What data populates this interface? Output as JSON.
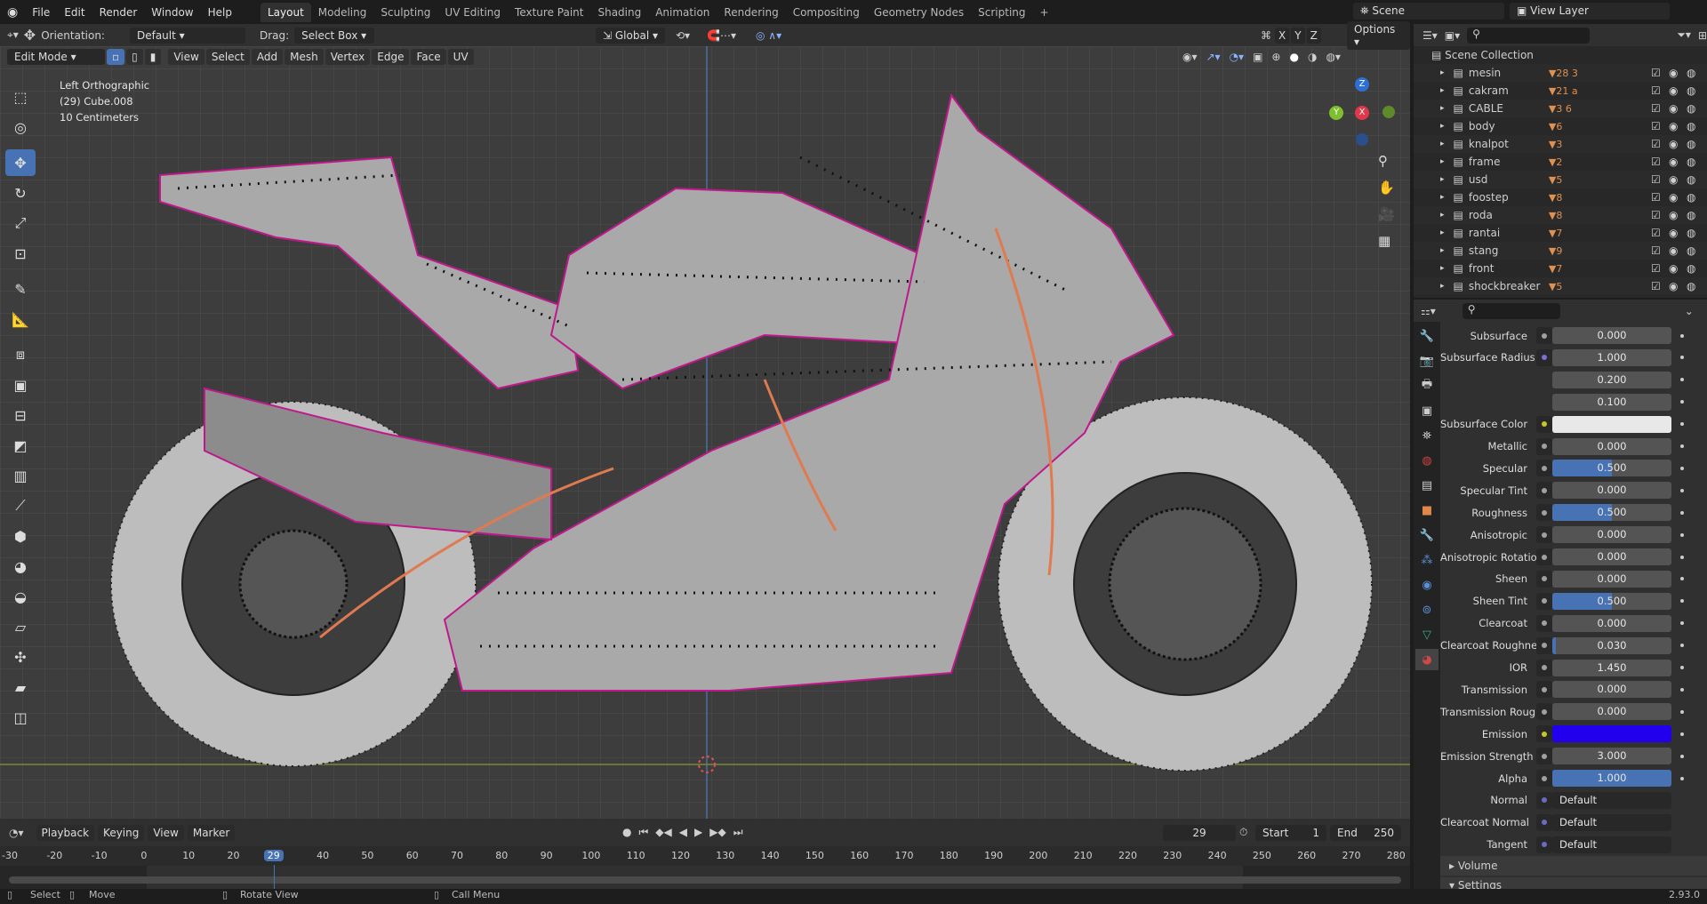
{
  "menu": [
    "File",
    "Edit",
    "Render",
    "Window",
    "Help"
  ],
  "workspaces": [
    "Layout",
    "Modeling",
    "Sculpting",
    "UV Editing",
    "Texture Paint",
    "Shading",
    "Animation",
    "Rendering",
    "Compositing",
    "Geometry Nodes",
    "Scripting"
  ],
  "scene": "Scene",
  "view_layer": "View Layer",
  "tool_header": {
    "orientation_label": "Orientation:",
    "orientation": "Default",
    "drag_label": "Drag:",
    "drag": "Select Box",
    "transform": "Global",
    "options": "Options",
    "axes": [
      "X",
      "Y",
      "Z"
    ]
  },
  "viewport_header": {
    "mode": "Edit Mode",
    "menus": [
      "View",
      "Select",
      "Add",
      "Mesh",
      "Vertex",
      "Edge",
      "Face",
      "UV"
    ]
  },
  "viewport_info": [
    "Left Orthographic",
    "(29) Cube.008",
    "10 Centimeters"
  ],
  "gizmo": {
    "z": "Z",
    "y": "Y",
    "x": "X"
  },
  "outliner": {
    "root": "Scene Collection",
    "items": [
      {
        "name": "mesin",
        "count": "28",
        "extra": "3"
      },
      {
        "name": "cakram",
        "count": "21",
        "extra": "a"
      },
      {
        "name": "CABLE",
        "count": "3",
        "extra": "6"
      },
      {
        "name": "body",
        "count": "6"
      },
      {
        "name": "knalpot",
        "count": "3"
      },
      {
        "name": "frame",
        "count": "2"
      },
      {
        "name": "usd",
        "count": "5"
      },
      {
        "name": "foostep",
        "count": "8"
      },
      {
        "name": "roda",
        "count": "8"
      },
      {
        "name": "rantai",
        "count": "7"
      },
      {
        "name": "stang",
        "count": "9"
      },
      {
        "name": "front",
        "count": "7"
      },
      {
        "name": "shockbreaker",
        "count": "5"
      }
    ]
  },
  "properties": [
    {
      "label": "Subsurface",
      "value": "0.000",
      "fill": 0
    },
    {
      "label": "Subsurface Radius",
      "value": "1.000",
      "fill": 0,
      "socket": "#7b6fd6"
    },
    {
      "label": "",
      "value": "0.200",
      "fill": 0
    },
    {
      "label": "",
      "value": "0.100",
      "fill": 0
    },
    {
      "label": "Subsurface Color",
      "value": "",
      "color": "#e8e8e8",
      "socket": "#c7c729"
    },
    {
      "label": "Metallic",
      "value": "0.000",
      "fill": 0
    },
    {
      "label": "Specular",
      "value": "0.500",
      "fill": 0.5
    },
    {
      "label": "Specular Tint",
      "value": "0.000",
      "fill": 0
    },
    {
      "label": "Roughness",
      "value": "0.500",
      "fill": 0.5
    },
    {
      "label": "Anisotropic",
      "value": "0.000",
      "fill": 0
    },
    {
      "label": "Anisotropic Rotation",
      "value": "0.000",
      "fill": 0
    },
    {
      "label": "Sheen",
      "value": "0.000",
      "fill": 0
    },
    {
      "label": "Sheen Tint",
      "value": "0.500",
      "fill": 0.5
    },
    {
      "label": "Clearcoat",
      "value": "0.000",
      "fill": 0
    },
    {
      "label": "Clearcoat Roughnes",
      "value": "0.030",
      "fill": 0.03
    },
    {
      "label": "IOR",
      "value": "1.450",
      "fill": 0
    },
    {
      "label": "Transmission",
      "value": "0.000",
      "fill": 0
    },
    {
      "label": "Transmission Roug...",
      "value": "0.000",
      "fill": 0
    },
    {
      "label": "Emission",
      "value": "",
      "color": "#2200ee",
      "socket": "#c7c729"
    },
    {
      "label": "Emission Strength",
      "value": "3.000",
      "fill": 0
    },
    {
      "label": "Alpha",
      "value": "1.000",
      "fill": 1
    },
    {
      "label": "Normal",
      "value": "Default",
      "link": true
    },
    {
      "label": "Clearcoat Normal",
      "value": "Default",
      "link": true
    },
    {
      "label": "Tangent",
      "value": "Default",
      "link": true
    }
  ],
  "panels": {
    "volume": "Volume",
    "settings": "Settings"
  },
  "timeline": {
    "menus": [
      "Playback",
      "Keying",
      "View",
      "Marker"
    ],
    "current_frame": "29",
    "start_label": "Start",
    "start": "1",
    "end_label": "End",
    "end": "250",
    "ticks": [
      "-30",
      "-20",
      "-10",
      "0",
      "10",
      "20",
      "29",
      "40",
      "50",
      "60",
      "70",
      "80",
      "90",
      "100",
      "110",
      "120",
      "130",
      "140",
      "150",
      "160",
      "170",
      "180",
      "190",
      "200",
      "210",
      "220",
      "230",
      "240",
      "250",
      "260",
      "270",
      "280"
    ]
  },
  "status": {
    "select": "Select",
    "move": "Move",
    "rotate": "Rotate View",
    "menu": "Call Menu",
    "version": "2.93.0"
  },
  "colors": {
    "accent": "#4772b3",
    "selected_edge": "#c0188c",
    "tire": "#cfcfcf"
  }
}
